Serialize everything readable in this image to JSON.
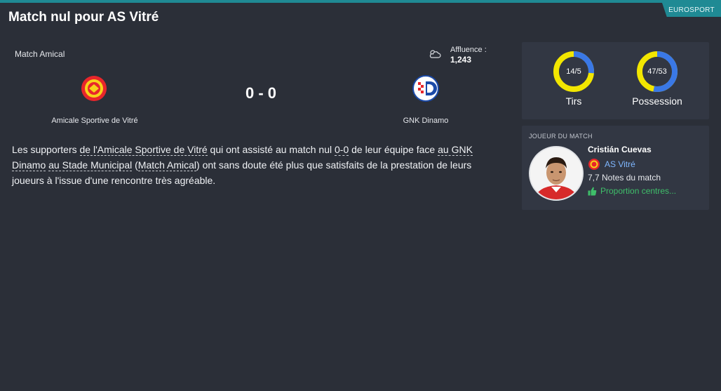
{
  "header": {
    "title": "Match nul pour AS Vitré",
    "source": "EUROSPORT"
  },
  "match": {
    "type": "Match Amical",
    "attendance_label": "Affluence :",
    "attendance_value": "1,243",
    "weather_icon": "cloudy-icon",
    "score": "0 - 0",
    "home_team": "Amicale Sportive de Vitré",
    "away_team": "GNK Dinamo"
  },
  "report": {
    "p1": "Les supporters ",
    "link_club": "de l'Amicale Sportive de Vitré",
    "p2": " qui ont assisté au match nul ",
    "link_score": "0-0",
    "p3": " de leur équipe face ",
    "link_opponent": "au GNK Dinamo",
    "p4": " ",
    "link_stadium": "au Stade Municipal",
    "p5": " (",
    "link_competition": "Match Amical",
    "p6": ") ont sans doute été plus que satisfaits de la prestation de leurs joueurs à l'issue d'une rencontre très agréable."
  },
  "stats": {
    "shots": {
      "label": "Tirs",
      "value": "14/5",
      "home": 14,
      "away": 5
    },
    "possession": {
      "label": "Possession",
      "value": "47/53",
      "home": 47,
      "away": 53
    }
  },
  "motm": {
    "header": "JOUEUR DU MATCH",
    "name": "Cristián Cuevas",
    "club": "AS Vitré",
    "rating": "7,7 Notes du match",
    "stat": "Proportion centres..."
  },
  "colors": {
    "home": "#f2e600",
    "away": "#3a78e6",
    "accent": "#1f8a94",
    "positive": "#3fbf6a"
  }
}
